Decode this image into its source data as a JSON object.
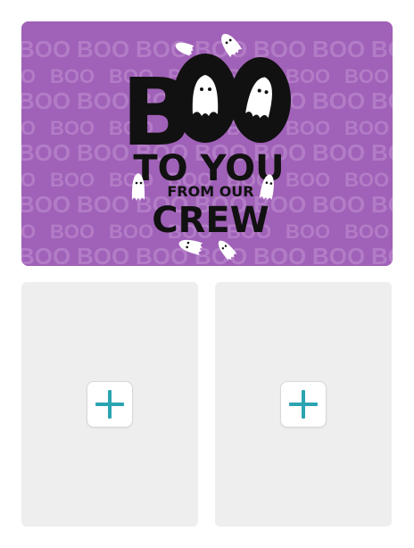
{
  "card": {
    "background_color": "#a061b8",
    "watermark_word": "BOO",
    "headline_word": "BOO",
    "line_two": "TO YOU",
    "line_three": "FROM OUR",
    "line_four": "CREW"
  },
  "photo_slots": [
    {
      "icon": "plus-icon",
      "accent_color": "#2aa4b1",
      "action": "Add photo"
    },
    {
      "icon": "plus-icon",
      "accent_color": "#2aa4b1",
      "action": "Add photo"
    }
  ]
}
